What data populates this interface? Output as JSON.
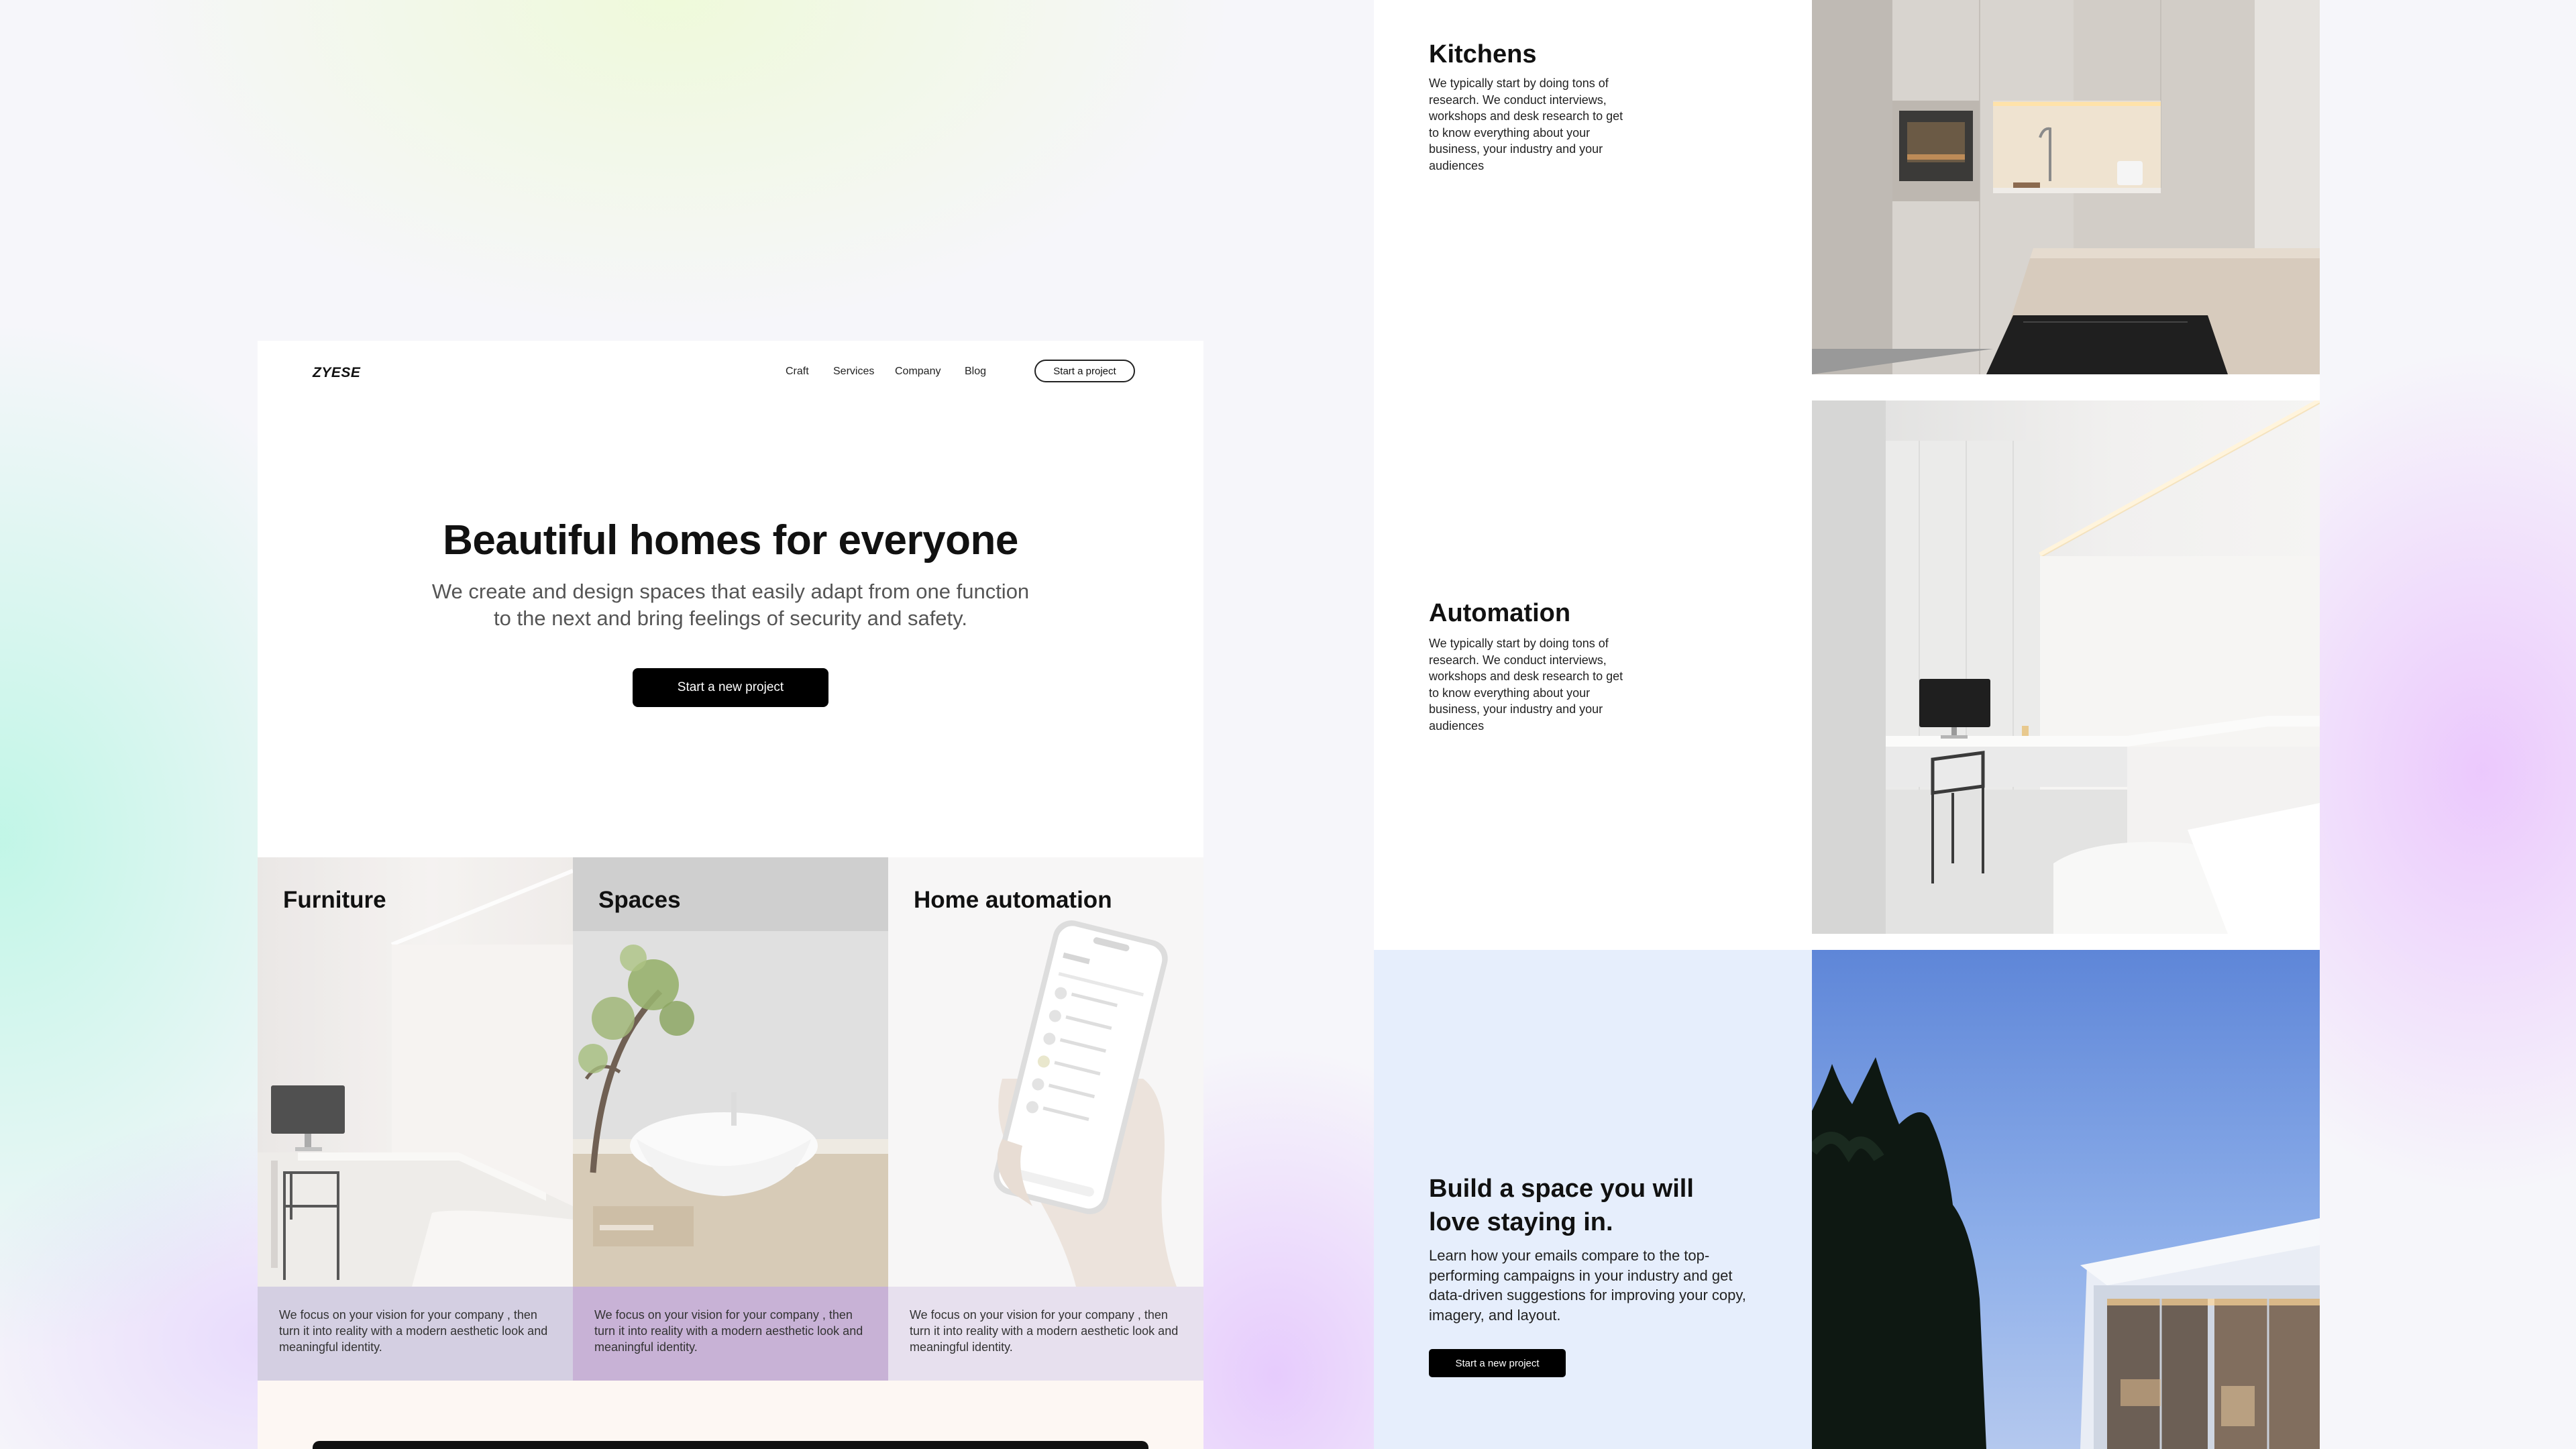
{
  "landing": {
    "logo": "ZYESE",
    "nav": [
      "Craft",
      "Services",
      "Company",
      "Blog"
    ],
    "nav_cta": "Start a project",
    "hero": {
      "title": "Beautiful homes for everyone",
      "subtitle_line1": "We create and design spaces that easily adapt from one function",
      "subtitle_line2": "to the next and bring feelings of security and safety.",
      "cta": "Start a new project"
    },
    "cards": [
      {
        "title": "Furniture",
        "text": "We focus on your vision for your company , then turn it into reality with a modern aesthetic look and meaningful identity.",
        "color": "#d4cfe2"
      },
      {
        "title": "Spaces",
        "text": "We focus on your vision for your company , then turn it into reality with a modern aesthetic look and meaningful identity.",
        "color": "#c8b2d6"
      },
      {
        "title": "Home automation",
        "text": "We focus on your vision for your company , then turn it into reality with a modern aesthetic look and meaningful identity.",
        "color": "#e7e0ee"
      }
    ]
  },
  "services_page": {
    "kitchens": {
      "title": "Kitchens",
      "text": "We typically start by doing tons of research. We conduct interviews, workshops and desk research to get to know everything about your business, your industry and your audiences"
    },
    "automation": {
      "title": "Automation",
      "text": "We typically start by doing tons of research. We conduct interviews, workshops and desk research to get to know everything about your business, your industry and your audiences"
    },
    "cta": {
      "title": "Build a space you will love staying in.",
      "text": "Learn how your emails compare to the top-performing campaigns in your industry and get data-driven suggestions for improving your copy, imagery, and layout.",
      "button": "Start a new project"
    }
  },
  "colors": {
    "accent": "#000000",
    "cta_panel": "#e6eefc",
    "card_furniture": "#d4cfe2",
    "card_spaces": "#c8b2d6",
    "card_automation": "#e7e0ee"
  }
}
